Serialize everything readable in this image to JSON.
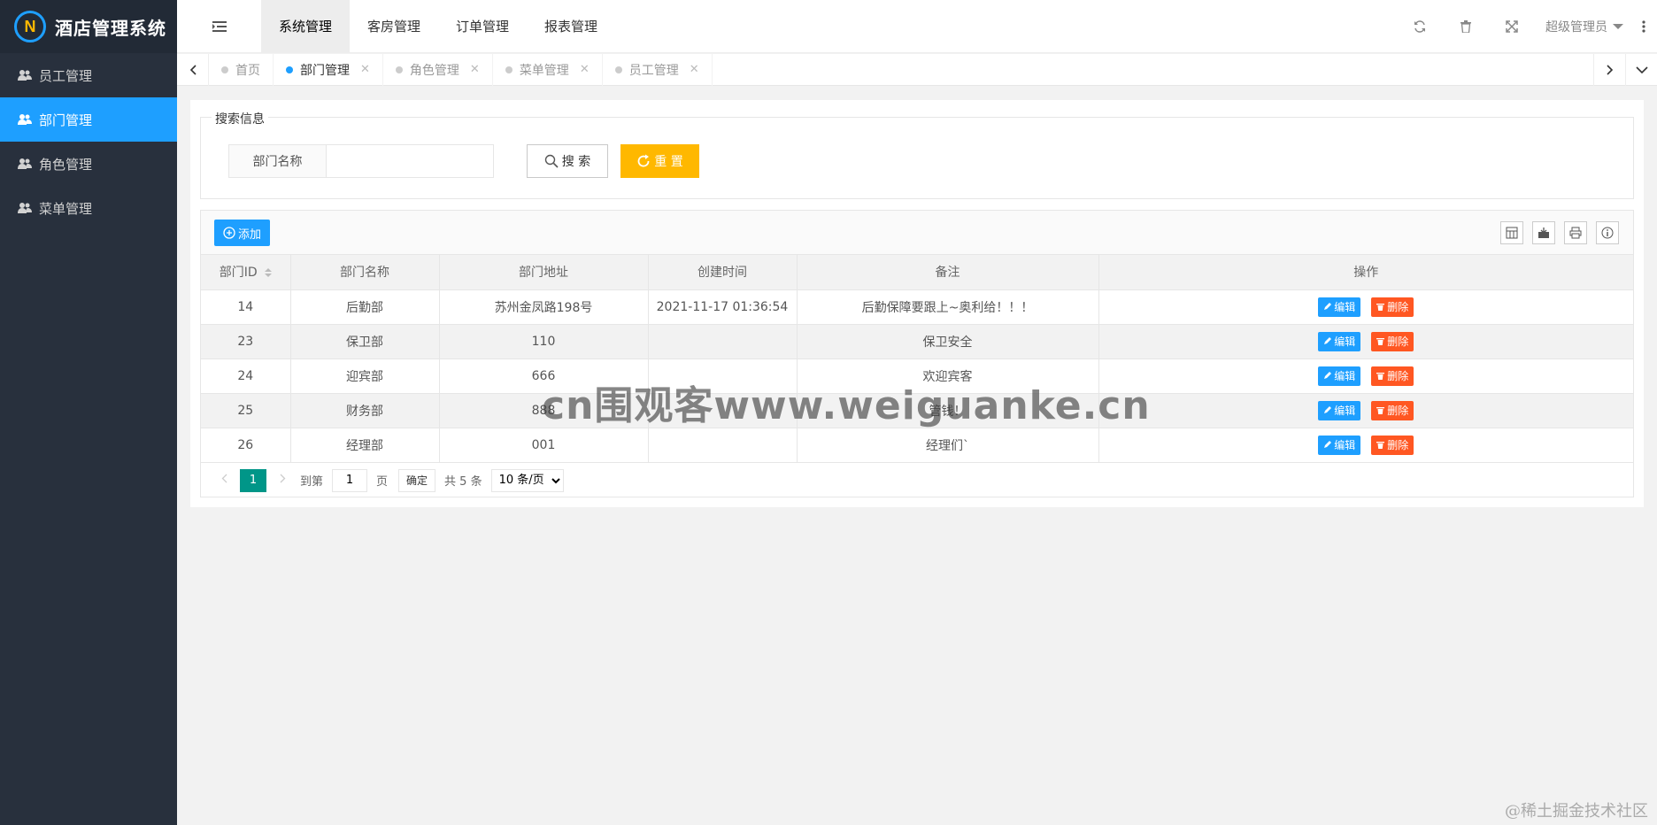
{
  "app": {
    "title": "酒店管理系统",
    "logo_letter": "N"
  },
  "sidebar": {
    "items": [
      {
        "label": "员工管理",
        "icon": "users-icon"
      },
      {
        "label": "部门管理",
        "icon": "users-icon",
        "active": true
      },
      {
        "label": "角色管理",
        "icon": "users-icon"
      },
      {
        "label": "菜单管理",
        "icon": "users-icon"
      }
    ]
  },
  "topnav": {
    "tabs": [
      {
        "label": "系统管理",
        "active": true
      },
      {
        "label": "客房管理"
      },
      {
        "label": "订单管理"
      },
      {
        "label": "报表管理"
      }
    ],
    "user": "超级管理员"
  },
  "pagetabs": [
    {
      "label": "首页"
    },
    {
      "label": "部门管理",
      "active": true
    },
    {
      "label": "角色管理"
    },
    {
      "label": "菜单管理"
    },
    {
      "label": "员工管理"
    }
  ],
  "search": {
    "legend": "搜索信息",
    "field_label": "部门名称",
    "field_value": "",
    "search_btn": "搜 索",
    "reset_btn": "重 置"
  },
  "toolbar": {
    "add_label": "添加"
  },
  "table": {
    "columns": [
      "部门ID",
      "部门名称",
      "部门地址",
      "创建时间",
      "备注",
      "操作"
    ],
    "rows": [
      [
        "14",
        "后勤部",
        "苏州金凤路198号",
        "2021-11-17 01:36:54",
        "后勤保障要跟上~奥利给！！！"
      ],
      [
        "23",
        "保卫部",
        "110",
        "",
        "保卫安全"
      ],
      [
        "24",
        "迎宾部",
        "666",
        "",
        "欢迎宾客"
      ],
      [
        "25",
        "财务部",
        "888",
        "",
        "管钱！"
      ],
      [
        "26",
        "经理部",
        "001",
        "",
        "经理们`"
      ]
    ],
    "edit_label": "编辑",
    "delete_label": "删除"
  },
  "pager": {
    "current": "1",
    "goto_label": "到第",
    "page_input": "1",
    "page_suffix": "页",
    "confirm": "确定",
    "total": "共 5 条",
    "page_size": "10 条/页"
  },
  "watermark": "cn围观客www.weiguanke.cn",
  "corner_mark": "@稀土掘金技术社区",
  "colors": {
    "accent": "#1e9fff",
    "warn": "#ffb800",
    "danger": "#ff5722",
    "pager": "#009688",
    "sidebar": "#28303d"
  }
}
